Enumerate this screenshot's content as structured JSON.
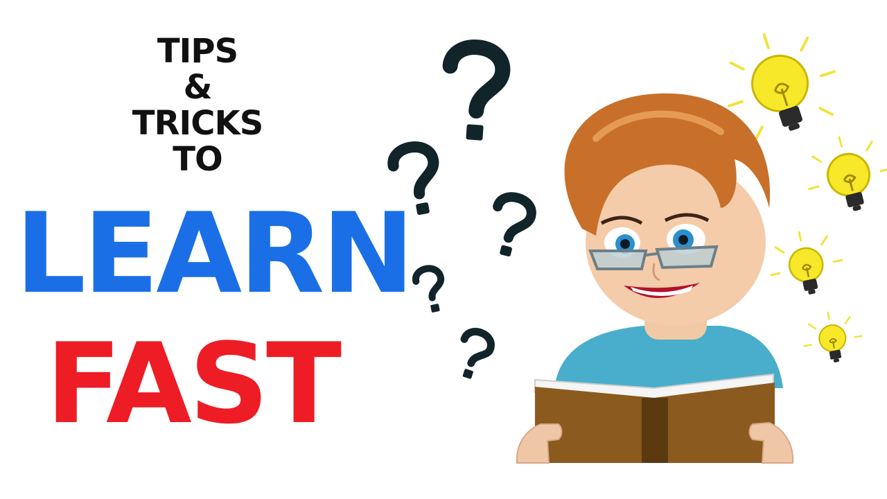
{
  "headline": {
    "lines": [
      "TIPS",
      "&",
      "TRICKS",
      "TO"
    ],
    "word1": "LEARN",
    "word2": "FAST"
  },
  "colors": {
    "background": "#ffffff",
    "headline_dark": "#111111",
    "learn_blue": "#1a6fe6",
    "fast_red": "#ee1c24",
    "question_mark": "#11242a",
    "hair": "#c8702a",
    "sweater": "#49aecb",
    "book_cover": "#8b5a1e",
    "bulb_yellow": "#f7e82a"
  },
  "icons": [
    "question-mark-icon",
    "light-bulb-icon"
  ]
}
